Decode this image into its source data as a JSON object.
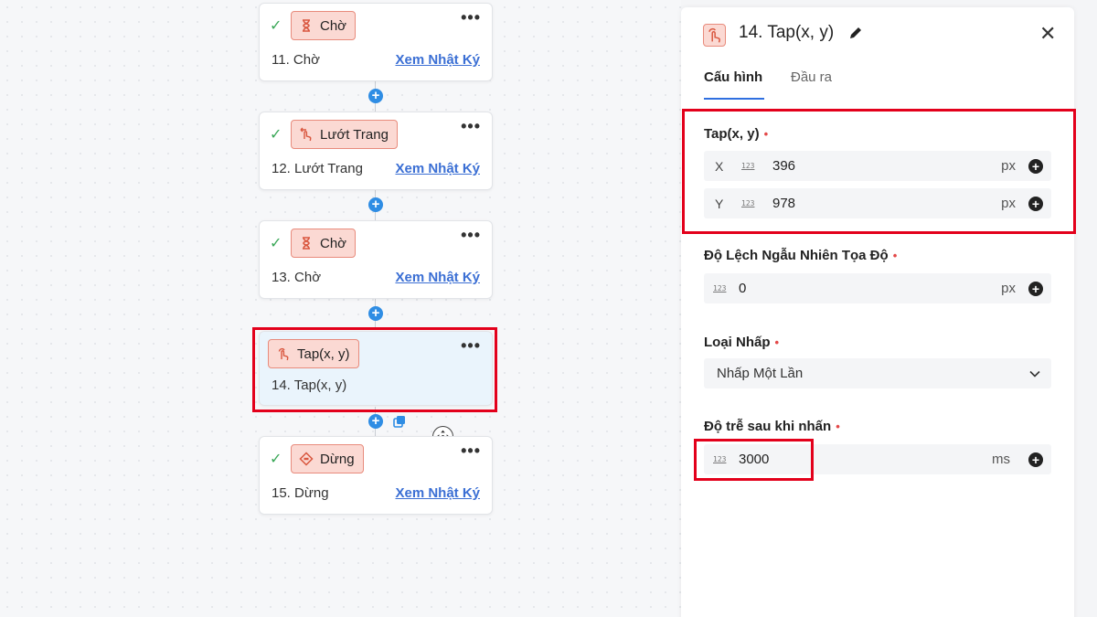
{
  "flow": {
    "nodes": [
      {
        "tag": "Chờ",
        "icon": "hourglass-icon",
        "title": "11. Chờ",
        "link": "Xem Nhật Ký",
        "done": true
      },
      {
        "tag": "Lướt Trang",
        "icon": "swipe-icon",
        "title": "12. Lướt Trang",
        "link": "Xem Nhật Ký",
        "done": true
      },
      {
        "tag": "Chờ",
        "icon": "hourglass-icon",
        "title": "13. Chờ",
        "link": "Xem Nhật Ký",
        "done": true
      },
      {
        "tag": "Tap(x, y)",
        "icon": "tap-icon",
        "title": "14. Tap(x, y)",
        "link": "",
        "done": false
      },
      {
        "tag": "Dừng",
        "icon": "stop-icon",
        "title": "15. Dừng",
        "link": "Xem Nhật Ký",
        "done": true
      }
    ],
    "check_symbol": "✓",
    "menu_symbol": "•••",
    "plus_symbol": "+"
  },
  "panel": {
    "title": "14. Tap(x, y)",
    "close_symbol": "✕",
    "tabs": [
      {
        "label": "Cấu hình",
        "active": true
      },
      {
        "label": "Đầu ra",
        "active": false
      }
    ],
    "tap": {
      "label": "Tap(x, y)",
      "x": {
        "axis": "X",
        "value": "396",
        "unit": "px"
      },
      "y": {
        "axis": "Y",
        "value": "978",
        "unit": "px"
      }
    },
    "offset": {
      "label": "Độ Lệch Ngẫu Nhiên Tọa Độ",
      "value": "0",
      "unit": "px"
    },
    "click_type": {
      "label": "Loại Nhấp",
      "value": "Nhấp Một Lần"
    },
    "delay": {
      "label": "Độ trễ sau khi nhấn",
      "value": "3000",
      "unit": "ms"
    },
    "required_mark": "•",
    "num_icon_text": "123",
    "plus_symbol": "+"
  },
  "colors": {
    "accent": "#2f8de4",
    "tag_bg": "#fbd9d3",
    "tag_border": "#e88b7c",
    "highlight": "#e3001b",
    "link": "#3b6fd4",
    "check": "#3aa757"
  }
}
